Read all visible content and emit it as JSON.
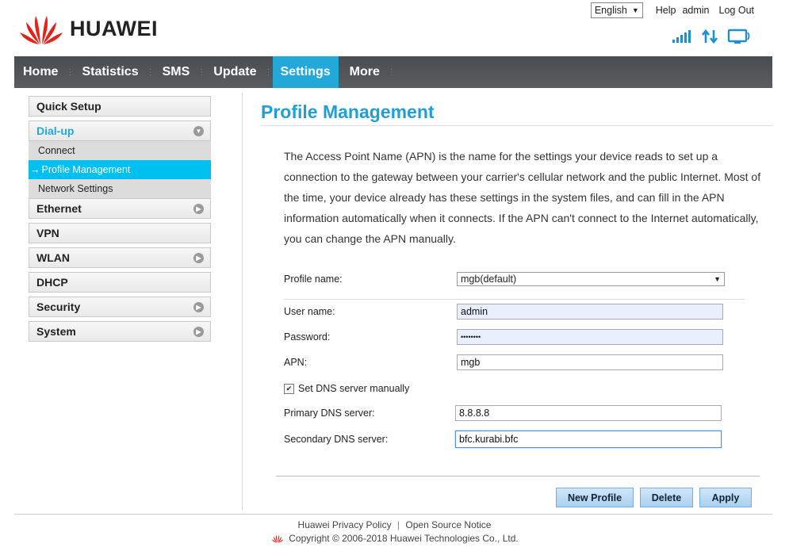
{
  "brand": {
    "name": "HUAWEI",
    "color": "#e2231a"
  },
  "toplinks": {
    "language": "English",
    "help": "Help",
    "user": "admin",
    "logout": "Log Out"
  },
  "status_icons": [
    "signal-icon",
    "data-transfer-icon",
    "device-monitor-icon"
  ],
  "nav": {
    "items": [
      "Home",
      "Statistics",
      "SMS",
      "Update",
      "Settings",
      "More"
    ],
    "active": "Settings",
    "accent": "#22a9da"
  },
  "sidebar": {
    "quick_setup": "Quick Setup",
    "dialup": "Dial-up",
    "dialup_items": [
      "Connect",
      "Profile Management",
      "Network Settings"
    ],
    "active_item_prefix": "→",
    "ethernet": "Ethernet",
    "vpn": "VPN",
    "wlan": "WLAN",
    "dhcp": "DHCP",
    "security": "Security",
    "system": "System"
  },
  "main": {
    "title": "Profile Management",
    "description": "The Access Point Name (APN) is the name for the settings your device reads to set up a connection to the gateway between your carrier's cellular network and the public Internet. Most of the time, your device already has these settings in the system files, and can fill in the APN information automatically when it connects. If the APN can't connect to the Internet automatically, you can change the APN manually."
  },
  "form": {
    "profile_name_label": "Profile name:",
    "profile_name_value": "mgb(default)",
    "username_label": "User name:",
    "username_value": "admin",
    "password_label": "Password:",
    "password_value": "••••••••",
    "apn_label": "APN:",
    "apn_value": "mgb",
    "dns_checkbox_label": "Set DNS server manually",
    "dns_checked": true,
    "primary_dns_label": "Primary DNS server:",
    "primary_dns_value": "8.8.8.8",
    "secondary_dns_label": "Secondary DNS server:",
    "secondary_dns_value": "bfc.kurabi.bfc"
  },
  "buttons": {
    "new_profile": "New Profile",
    "delete": "Delete",
    "apply": "Apply"
  },
  "footer": {
    "privacy": "Huawei Privacy Policy",
    "open_source": "Open Source Notice",
    "copyright": "Copyright © 2006-2018 Huawei Technologies Co., Ltd."
  }
}
